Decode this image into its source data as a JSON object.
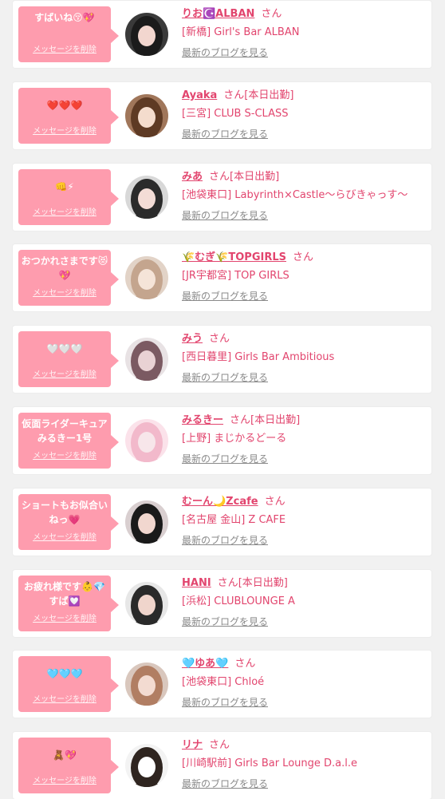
{
  "accent_color": "#fe9cae",
  "name_color": "#e2456e",
  "messages": [
    {
      "message": "すばいね😚💖",
      "delete_label": "メッセージを削除",
      "user_name": "りお☪️ALBAN",
      "honorific": "さん",
      "on_duty": "",
      "shop": "[新橋] Girl's Bar ALBAN",
      "blog_link": "最新のブログを見る",
      "avatar_icon": "photo-dark-hair"
    },
    {
      "message": "❤️❤️❤️",
      "delete_label": "メッセージを削除",
      "user_name": "Ayaka",
      "honorific": "さん",
      "on_duty": "[本日出勤]",
      "shop": "[三宮] CLUB S-CLASS",
      "blog_link": "最新のブログを見る",
      "avatar_icon": "photo-peace-sign"
    },
    {
      "message": "👊⚡",
      "delete_label": "メッセージを削除",
      "user_name": "みあ",
      "honorific": "さん",
      "on_duty": "[本日出勤]",
      "shop": "[池袋東口] Labyrinth×Castle～らびきゃっす～",
      "blog_link": "最新のブログを見る",
      "avatar_icon": "photo-angel-wings"
    },
    {
      "message": "おつかれさまです😻💖",
      "delete_label": "メッセージを削除",
      "user_name": "🌾むぎ🌾TOPGIRLS",
      "honorific": "さん",
      "on_duty": "",
      "shop": "[JR宇都宮] TOP GIRLS",
      "blog_link": "最新のブログを見る",
      "avatar_icon": "photo-light-hair"
    },
    {
      "message": "🤍🤍🤍",
      "delete_label": "メッセージを削除",
      "user_name": "みう",
      "honorific": "さん",
      "on_duty": "",
      "shop": "[西日暮里] Girls Bar Ambitious",
      "blog_link": "最新のブログを見る",
      "avatar_icon": "photo-long-hair"
    },
    {
      "message": "仮面ライダーキュアみるきー1号",
      "delete_label": "メッセージを削除",
      "user_name": "みるきー",
      "honorific": "さん",
      "on_duty": "[本日出勤]",
      "shop": "[上野] まじかるどーる",
      "blog_link": "最新のブログを見る",
      "avatar_icon": "photo-pink-soft"
    },
    {
      "message": "ショートもお似合いねっ💗",
      "delete_label": "メッセージを削除",
      "user_name": "むーん🌙Zcafe",
      "honorific": "さん",
      "on_duty": "",
      "shop": "[名古屋 金山] Z CAFE",
      "blog_link": "最新のブログを見る",
      "avatar_icon": "photo-short-hair"
    },
    {
      "message": "お疲れ様です👶💎すば💟",
      "delete_label": "メッセージを削除",
      "user_name": "HANI",
      "honorific": "さん",
      "on_duty": "[本日出勤]",
      "shop": "[浜松] CLUBLOUNGE A",
      "blog_link": "最新のブログを見る",
      "avatar_icon": "photo-side-face"
    },
    {
      "message": "🩵🩵🩵",
      "delete_label": "メッセージを削除",
      "user_name": "🩵ゆあ🩵",
      "honorific": "さん",
      "on_duty": "",
      "shop": "[池袋東口] Chloé",
      "blog_link": "最新のブログを見る",
      "avatar_icon": "photo-bangs"
    },
    {
      "message": "🧸💖",
      "delete_label": "メッセージを削除",
      "user_name": "リナ",
      "honorific": "さん",
      "on_duty": "",
      "shop": "[川崎駅前] Girls Bar Lounge D.a.l.e",
      "blog_link": "最新のブログを見る",
      "avatar_icon": "photo-heart-face"
    }
  ]
}
